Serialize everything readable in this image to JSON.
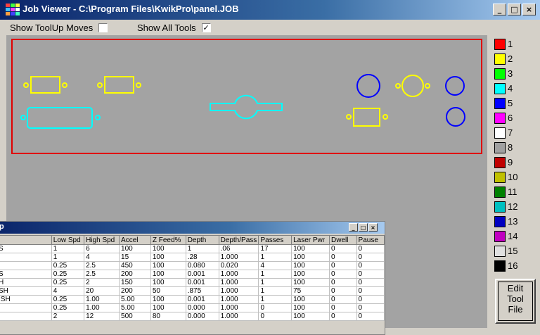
{
  "window": {
    "title": "Job Viewer - C:\\Program Files\\KwikPro\\panel.JOB"
  },
  "window_buttons": [
    "_",
    "□",
    "×"
  ],
  "options": [
    {
      "label": "Show ToolUp Moves",
      "checked": false,
      "mark": ""
    },
    {
      "label": "Show All Tools",
      "checked": true,
      "mark": "✓"
    }
  ],
  "palette": [
    {
      "num": "1",
      "color": "#ff0000"
    },
    {
      "num": "2",
      "color": "#ffff00"
    },
    {
      "num": "3",
      "color": "#00ff00"
    },
    {
      "num": "4",
      "color": "#00ffff"
    },
    {
      "num": "5",
      "color": "#0000ff"
    },
    {
      "num": "6",
      "color": "#ff00ff"
    },
    {
      "num": "7",
      "color": "#ffffff"
    },
    {
      "num": "8",
      "color": "#a0a0a0"
    },
    {
      "num": "9",
      "color": "#c00000"
    },
    {
      "num": "10",
      "color": "#c0c000"
    },
    {
      "num": "11",
      "color": "#008000"
    },
    {
      "num": "12",
      "color": "#00c0c0"
    },
    {
      "num": "13",
      "color": "#0000c0"
    },
    {
      "num": "14",
      "color": "#c000c0"
    },
    {
      "num": "15",
      "color": "#e0e0e0"
    },
    {
      "num": "16",
      "color": "#000000"
    }
  ],
  "edit_button": {
    "line1": "Edit",
    "line2": "Tool",
    "line3": "File"
  },
  "subwindow": {
    "title": "p",
    "buttons": [
      "_",
      "□",
      "×"
    ],
    "columns": [
      "",
      "Low Spd",
      "High Spd",
      "Accel",
      "Z Feed%",
      "Depth",
      "Depth/Pass",
      "Passes",
      "Laser Pwr",
      "Dwell",
      "Pause"
    ],
    "rows": [
      [
        "S",
        "1",
        "6",
        "100",
        "100",
        "1",
        ".06",
        "17",
        "100",
        "0",
        "0"
      ],
      [
        "",
        "1",
        "4",
        "15",
        "100",
        ".28",
        "1.000",
        "1",
        "100",
        "0",
        "0"
      ],
      [
        "",
        "0.25",
        "2.5",
        "450",
        "100",
        "0.080",
        "0.020",
        "4",
        "100",
        "0",
        "0"
      ],
      [
        "S",
        "0.25",
        "2.5",
        "200",
        "100",
        "0.001",
        "1.000",
        "1",
        "100",
        "0",
        "0"
      ],
      [
        "H",
        "0.25",
        "2",
        "150",
        "100",
        "0.001",
        "1.000",
        "1",
        "100",
        "0",
        "0"
      ],
      [
        "SH",
        "4",
        "20",
        "200",
        "50",
        ".875",
        "1.000",
        "1",
        "75",
        "0",
        "0"
      ],
      [
        "ISH",
        "0.25",
        "1.00",
        "5.00",
        "100",
        "0.001",
        "1.000",
        "1",
        "100",
        "0",
        "0"
      ],
      [
        "",
        "0.25",
        "1.00",
        "5.00",
        "100",
        "0.000",
        "1.000",
        "0",
        "100",
        "0",
        "0"
      ],
      [
        "",
        "2",
        "12",
        "500",
        "80",
        "0.000",
        "1.000",
        "0",
        "100",
        "0",
        "0"
      ]
    ]
  },
  "shape_colors": {
    "yellow": "#ffff00",
    "cyan": "#00ffff",
    "blue": "#0000ff",
    "frame": "#e00000"
  }
}
